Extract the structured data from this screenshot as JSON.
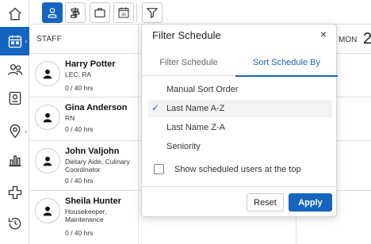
{
  "toolbar": {
    "buttons": [
      "person-icon",
      "timeline-icon",
      "briefcase-icon",
      "calendar-30-icon"
    ],
    "calendar_num": "30",
    "filter_icon": "filter-icon"
  },
  "rail": {
    "items": [
      "home-icon",
      "calendar-icon",
      "people-icon",
      "id-badge-icon",
      "location-icon",
      "chart-icon",
      "medical-cross-icon",
      "history-icon"
    ],
    "accent": "#1565c0"
  },
  "grid": {
    "staff_header": "STAFF",
    "day_label": "MON",
    "day_number": "2"
  },
  "staff": [
    {
      "name": "Harry Potter",
      "role": "LEC, RA",
      "hours": "0 / 40 hrs"
    },
    {
      "name": "Gina Anderson",
      "role": "RN",
      "hours": "0 / 40 hrs"
    },
    {
      "name": "John Valjohn",
      "role": "Dietary Aide, Culinary Coordinator",
      "hours": "0 / 40 hrs"
    },
    {
      "name": "Sheila Hunter",
      "role": "Housekeeper, Maintenance",
      "hours": "0 / 40 hrs"
    }
  ],
  "modal": {
    "title": "Filter Schedule",
    "close": "×",
    "tabs": [
      "Filter Schedule",
      "Sort Schedule By"
    ],
    "options": [
      "Manual Sort Order",
      "Last Name A-Z",
      "Last Name Z-A",
      "Seniority"
    ],
    "selected_check": "✓",
    "checkbox_label": "Show scheduled users at the top",
    "reset_label": "Reset",
    "apply_label": "Apply"
  }
}
